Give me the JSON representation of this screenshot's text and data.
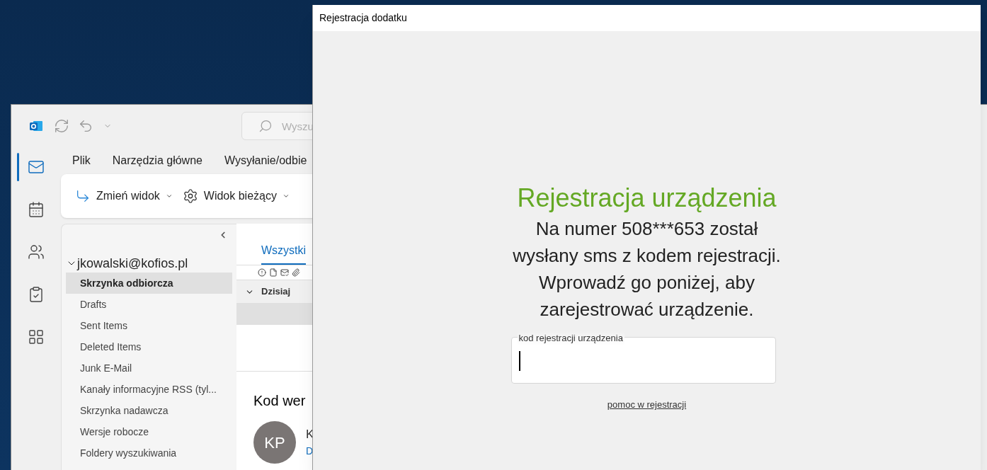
{
  "outlook": {
    "search": {
      "placeholder": "Wyszu"
    },
    "nav_rail": [
      {
        "kind": "mail",
        "selected": true
      },
      {
        "kind": "calendar",
        "selected": false
      },
      {
        "kind": "people",
        "selected": false
      },
      {
        "kind": "tasks",
        "selected": false
      },
      {
        "kind": "apps",
        "selected": false
      }
    ],
    "ribbon_tabs": [
      "Plik",
      "Narzędzia główne",
      "Wysyłanie/odbie"
    ],
    "ribbon_buttons": [
      {
        "kind": "change-view",
        "label": "Zmień widok"
      },
      {
        "kind": "current-view",
        "label": "Widok bieżący"
      }
    ],
    "account": {
      "label": "jkowalski@kofios.pl",
      "expanded": true
    },
    "folders": [
      {
        "label": "Skrzynka odbiorcza",
        "selected": true
      },
      {
        "label": "Drafts",
        "selected": false
      },
      {
        "label": "Sent Items",
        "selected": false
      },
      {
        "label": "Deleted Items",
        "selected": false
      },
      {
        "label": "Junk E-Mail",
        "selected": false
      },
      {
        "label": "Kanały informacyjne RSS (tyl...",
        "selected": false
      },
      {
        "label": "Skrzynka nadawcza",
        "selected": false
      },
      {
        "label": "Wersje robocze",
        "selected": false
      },
      {
        "label": "Foldery wyszukiwania",
        "selected": false
      }
    ],
    "mail_list": {
      "tab": "Wszystki",
      "group": "Dzisiaj",
      "heading": "Kod wer",
      "avatar": "KP",
      "sender": "K",
      "preview": "D"
    }
  },
  "dialog": {
    "title": "Rejestracja dodatku",
    "heading": "Rejestracja urządzenia",
    "message": "Na numer 508***653 został wysłany sms z kodem rejestracji. Wprowadź go poniżej, aby zarejestrować urządzenie.",
    "field": {
      "label": "kod rejestracji urządzenia"
    },
    "help_link": "pomoc w rejestracji"
  }
}
